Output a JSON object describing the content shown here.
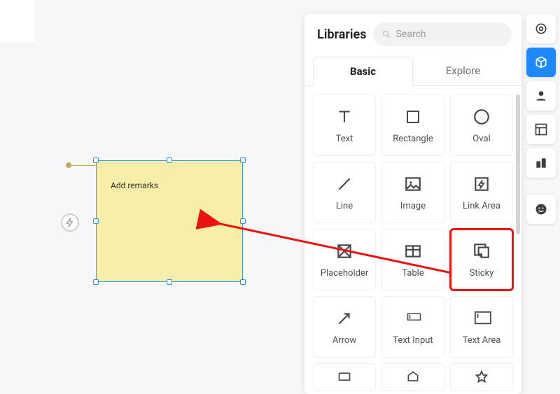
{
  "canvas": {
    "sticky_text": "Add remarks"
  },
  "panel": {
    "title": "Libraries",
    "search_placeholder": "Search",
    "tabs": {
      "basic": "Basic",
      "explore": "Explore"
    },
    "items": [
      {
        "id": "text",
        "label": "Text"
      },
      {
        "id": "rectangle",
        "label": "Rectangle"
      },
      {
        "id": "oval",
        "label": "Oval"
      },
      {
        "id": "line",
        "label": "Line"
      },
      {
        "id": "image",
        "label": "Image"
      },
      {
        "id": "linkarea",
        "label": "Link Area"
      },
      {
        "id": "placeholder",
        "label": "Placeholder"
      },
      {
        "id": "table",
        "label": "Table"
      },
      {
        "id": "sticky",
        "label": "Sticky"
      },
      {
        "id": "arrow",
        "label": "Arrow"
      },
      {
        "id": "textinput",
        "label": "Text Input"
      },
      {
        "id": "textarea",
        "label": "Text Area"
      }
    ]
  },
  "annotation": {
    "target_item": "sticky"
  }
}
